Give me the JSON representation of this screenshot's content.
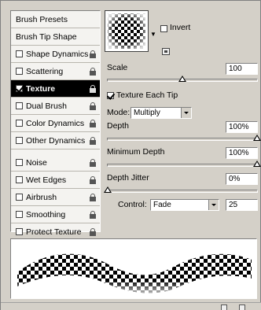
{
  "sidebar": {
    "items": [
      {
        "label": "Brush Presets",
        "checkbox": false,
        "checked": false,
        "lock": false,
        "selected": false
      },
      {
        "label": "Brush Tip Shape",
        "checkbox": false,
        "checked": false,
        "lock": false,
        "selected": false
      },
      {
        "label": "Shape Dynamics",
        "checkbox": true,
        "checked": false,
        "lock": true,
        "selected": false
      },
      {
        "label": "Scattering",
        "checkbox": true,
        "checked": false,
        "lock": true,
        "selected": false
      },
      {
        "label": "Texture",
        "checkbox": true,
        "checked": true,
        "lock": true,
        "selected": true
      },
      {
        "label": "Dual Brush",
        "checkbox": true,
        "checked": false,
        "lock": true,
        "selected": false
      },
      {
        "label": "Color Dynamics",
        "checkbox": true,
        "checked": false,
        "lock": true,
        "selected": false
      },
      {
        "label": "Other Dynamics",
        "checkbox": true,
        "checked": false,
        "lock": true,
        "selected": false
      },
      {
        "label": "Noise",
        "checkbox": true,
        "checked": false,
        "lock": true,
        "selected": false
      },
      {
        "label": "Wet Edges",
        "checkbox": true,
        "checked": false,
        "lock": true,
        "selected": false
      },
      {
        "label": "Airbrush",
        "checkbox": true,
        "checked": false,
        "lock": true,
        "selected": false
      },
      {
        "label": "Smoothing",
        "checkbox": true,
        "checked": false,
        "lock": true,
        "selected": false
      },
      {
        "label": "Protect Texture",
        "checkbox": true,
        "checked": false,
        "lock": true,
        "selected": false
      }
    ]
  },
  "texture": {
    "invert_label": "Invert",
    "invert_checked": false,
    "scale_label": "Scale",
    "scale_value": "100",
    "scale_slider_fraction": 0.5,
    "texture_each_tip_label": "Texture Each Tip",
    "texture_each_tip_checked": true,
    "mode_label": "Mode:",
    "mode_value": "Multiply",
    "depth_label": "Depth",
    "depth_value": "100%",
    "depth_slider_fraction": 1.0,
    "min_depth_label": "Minimum Depth",
    "min_depth_value": "100%",
    "min_depth_slider_fraction": 1.0,
    "depth_jitter_label": "Depth Jitter",
    "depth_jitter_value": "0%",
    "depth_jitter_slider_fraction": 0.0,
    "control_label": "Control:",
    "control_value": "Fade",
    "control_steps": "25"
  },
  "colors": {
    "panel_bg": "#d4d0c8",
    "list_bg": "#f4f3f0",
    "selected_bg": "#000000",
    "selected_fg": "#ffffff"
  }
}
